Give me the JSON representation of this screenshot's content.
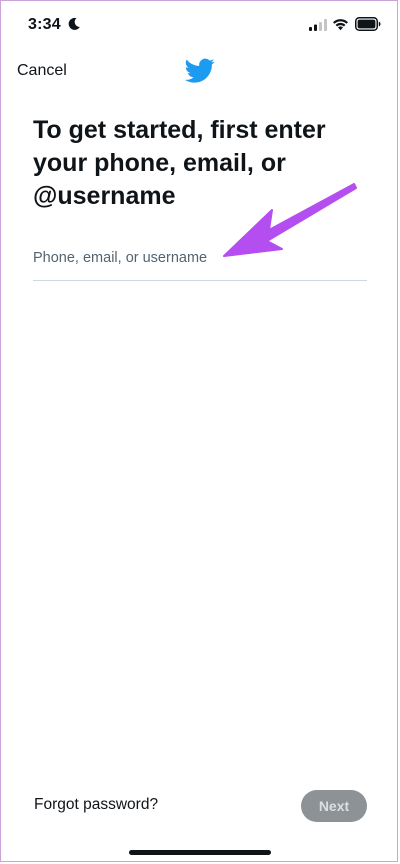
{
  "status_bar": {
    "time": "3:34"
  },
  "header": {
    "cancel_label": "Cancel",
    "logo_icon": "twitter-bird-icon",
    "brand_color": "#1d9bf0"
  },
  "main": {
    "title": "To get started, first enter your phone, email, or @username",
    "login_input": {
      "placeholder": "Phone, email, or username",
      "value": ""
    }
  },
  "annotation": {
    "arrow_color": "#b44ef0"
  },
  "footer": {
    "forgot_password_label": "Forgot password?",
    "next_label": "Next",
    "next_enabled": false
  }
}
